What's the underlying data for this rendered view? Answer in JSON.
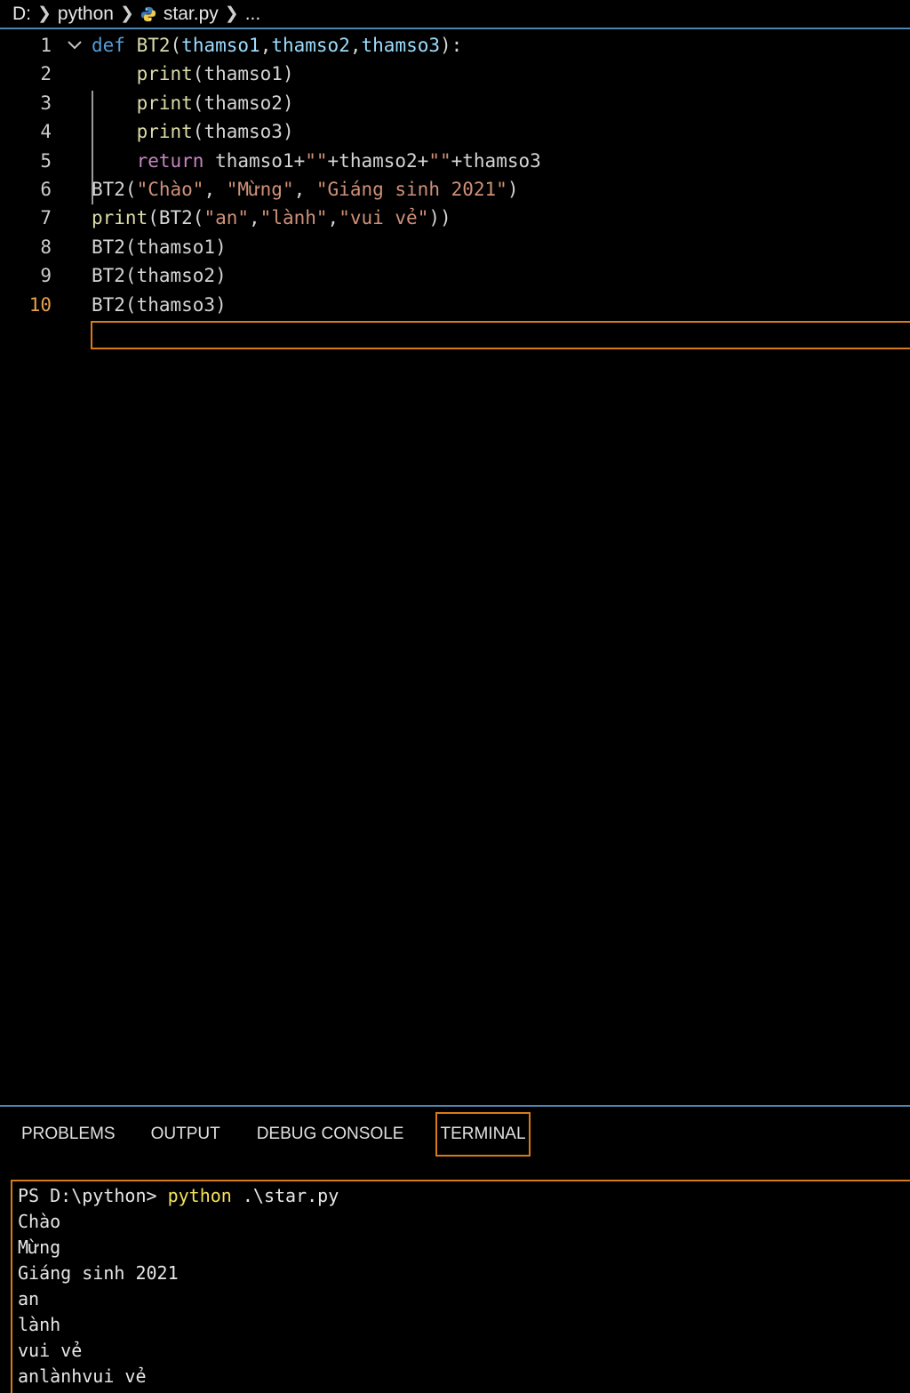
{
  "breadcrumb": {
    "drive": "D:",
    "folder": "python",
    "file": "star.py",
    "more": "..."
  },
  "editor": {
    "language_icon": "python-icon",
    "active_line": 10,
    "lines": [
      {
        "num": "1",
        "code": [
          [
            "kw",
            "def "
          ],
          [
            "fn",
            "BT2"
          ],
          [
            "txt",
            "("
          ],
          [
            "var",
            "thamso1"
          ],
          [
            "txt",
            ","
          ],
          [
            "var",
            "thamso2"
          ],
          [
            "txt",
            ","
          ],
          [
            "var",
            "thamso3"
          ],
          [
            "txt",
            "):"
          ]
        ]
      },
      {
        "num": "2",
        "code": [
          [
            "txt",
            "    "
          ],
          [
            "fn",
            "print"
          ],
          [
            "txt",
            "(thamso1)"
          ]
        ]
      },
      {
        "num": "3",
        "code": [
          [
            "txt",
            "    "
          ],
          [
            "fn",
            "print"
          ],
          [
            "txt",
            "(thamso2)"
          ]
        ]
      },
      {
        "num": "4",
        "code": [
          [
            "txt",
            "    "
          ],
          [
            "fn",
            "print"
          ],
          [
            "txt",
            "(thamso3)"
          ]
        ]
      },
      {
        "num": "5",
        "code": [
          [
            "txt",
            "    "
          ],
          [
            "kw2",
            "return"
          ],
          [
            "txt",
            " thamso1+"
          ],
          [
            "str",
            "\"\""
          ],
          [
            "txt",
            "+thamso2+"
          ],
          [
            "str",
            "\"\""
          ],
          [
            "txt",
            "+thamso3"
          ]
        ]
      },
      {
        "num": "6",
        "code": [
          [
            "txt",
            "BT2("
          ],
          [
            "str",
            "\"Chào\""
          ],
          [
            "txt",
            ", "
          ],
          [
            "str",
            "\"Mừng\""
          ],
          [
            "txt",
            ", "
          ],
          [
            "str",
            "\"Giáng sinh 2021\""
          ],
          [
            "txt",
            ")"
          ]
        ]
      },
      {
        "num": "7",
        "code": [
          [
            "fn",
            "print"
          ],
          [
            "txt",
            "(BT2("
          ],
          [
            "str",
            "\"an\""
          ],
          [
            "txt",
            ","
          ],
          [
            "str",
            "\"lành\""
          ],
          [
            "txt",
            ","
          ],
          [
            "str",
            "\"vui vẻ\""
          ],
          [
            "txt",
            "))"
          ]
        ]
      },
      {
        "num": "8",
        "code": [
          [
            "txt",
            "BT2(thamso1)"
          ]
        ]
      },
      {
        "num": "9",
        "code": [
          [
            "txt",
            "BT2(thamso2)"
          ]
        ]
      },
      {
        "num": "10",
        "code": [
          [
            "txt",
            "BT2(thamso3)"
          ]
        ]
      }
    ]
  },
  "panel": {
    "tabs": [
      "PROBLEMS",
      "OUTPUT",
      "DEBUG CONSOLE",
      "TERMINAL"
    ],
    "active_tab": "TERMINAL"
  },
  "terminal": {
    "prompt": "PS D:\\python> ",
    "command": "python",
    "args": " .\\star.py",
    "output": [
      "Chào",
      "Mừng",
      "Giáng sinh 2021",
      "an",
      "lành",
      "vui vẻ",
      "anlànhvui vẻ"
    ]
  },
  "colors": {
    "accent_focus": "#d97a1a",
    "divider": "#4e86b3",
    "keyword": "#569cd6",
    "function": "#dcdcaa",
    "string": "#ce9178",
    "return_keyword": "#c586c0"
  }
}
